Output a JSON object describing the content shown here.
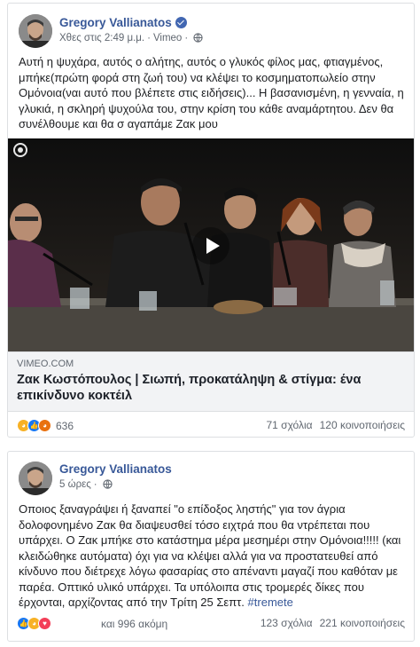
{
  "post1": {
    "author": "Gregory Vallianatos",
    "time": "Χθες στις 2:49 μ.μ.",
    "source": "Vimeo",
    "text": "Αυτή η ψυχάρα, αυτός ο αλήτης, αυτός ο γλυκός φίλος μας, φτιαγμένος, μπήκε(πρώτη φορά στη ζωή του) να κλέψει το κοσμηματοπωλείο στην Ομόνοια(ναι αυτό που βλέπετε στις ειδήσεις)... Η βασανισμένη, η γενναία, η γλυκιά, η σκληρή ψυχούλα του, στην κρίση του κάθε αναμάρτητου. Δεν θα συνέλθουμε και θα σ αγαπάμε Ζακ μου",
    "link_domain": "VIMEO.COM",
    "link_title": "Ζακ Κωστόπουλος | Σιωπή, προκατάληψη & στίγμα: ένα επικίνδυνο κοκτέιλ",
    "reaction_count": "636",
    "comments": "71 σχόλια",
    "shares": "120 κοινοποιήσεις"
  },
  "post2": {
    "author": "Gregory Vallianatos",
    "time": "5 ώρες",
    "text": "Οποιος ξαναγράψει ή ξαναπεί \"ο επίδοξος ληστής\" για τον άγρια δολοφονημένο Ζακ θα διαψευσθεί τόσο ειχτρά που θα ντρέπεται που υπάρχει. Ο Ζακ μπήκε στο κατάστημα μέρα μεσημέρι στην Ομόνοια!!!!! (και κλειδώθηκε αυτόματα) όχι για να κλέψει αλλά για να προστατευθεί από κίνδυνο που διέτρεχε λόγω φασαρίας στο απέναντι μαγαζί που καθόταν με παρέα. Οπτικό υλικό υπάρχει. Τα υπόλοιπα στις τρομερές δίκες που έρχονται, αρχίζοντας από την Τρίτη 25 Σεπτ. ",
    "hashtag": "#tremete",
    "reaction_count": "και 996 ακόμη",
    "comments": "123 σχόλια",
    "shares": "221 κοινοποιήσεις"
  },
  "colors": {
    "link_blue": "#385898",
    "meta_gray": "#606770",
    "border": "#dddfe2",
    "link_bg": "#f2f3f5"
  }
}
